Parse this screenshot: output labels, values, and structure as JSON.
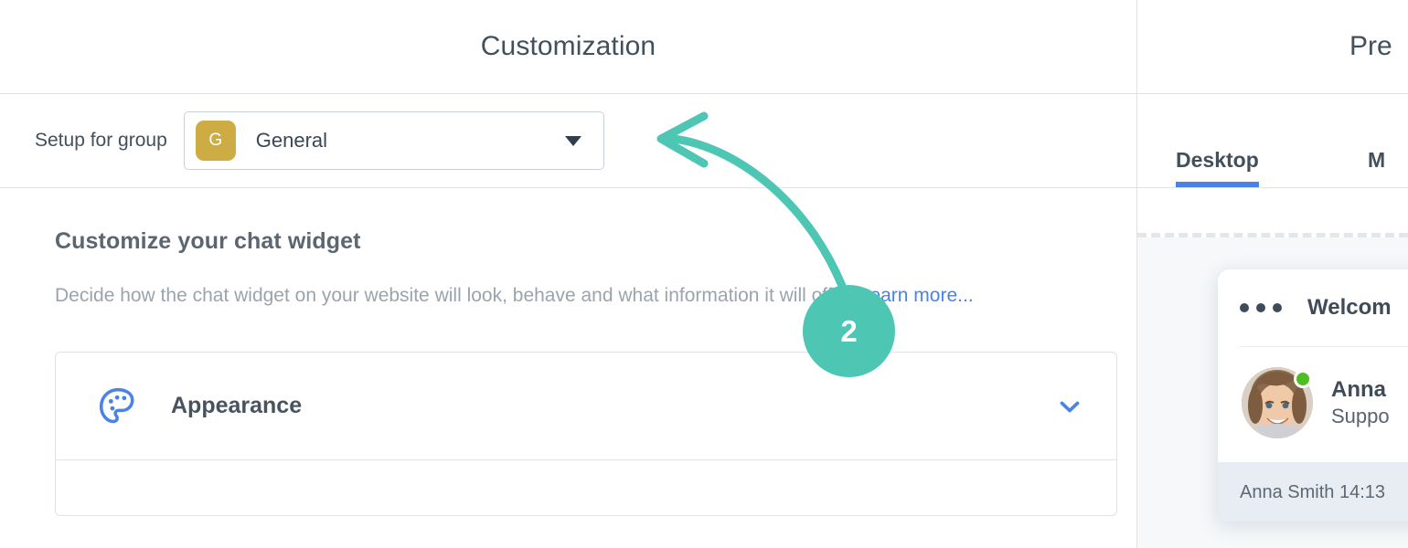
{
  "left": {
    "header": {
      "title": "Customization"
    },
    "group_bar": {
      "label": "Setup for group",
      "avatar_initial": "G",
      "avatar_color": "#ceac44",
      "selected_group": "General",
      "caret_icon": "caret-down-icon"
    },
    "content": {
      "title": "Customize your chat widget",
      "description": "Decide how the chat widget on your website will look, behave and what information it will offer. ",
      "learn_more": "Learn more...",
      "link_color": "#4a82e8"
    },
    "cards": [
      {
        "icon": "palette-icon",
        "label": "Appearance",
        "chevron": "chevron-down-icon",
        "icon_color": "#4a82e8"
      }
    ]
  },
  "right": {
    "header": {
      "title": "Pre"
    },
    "tabs": [
      {
        "label": "Desktop",
        "active": true
      },
      {
        "label": "M",
        "active": false
      }
    ],
    "active_tab_color": "#4a82e8",
    "widget": {
      "menu_icon": "ellipsis-icon",
      "welcome_title": "Welcom",
      "agent_name": "Anna",
      "agent_role": "Suppo",
      "online_status_color": "#4fbd24",
      "avatar_icon": "avatar",
      "message_meta": "Anna Smith 14:13"
    }
  },
  "annotation": {
    "step_number": "2",
    "accent_color": "#4ec6b4",
    "arrow_icon": "curved-arrow-icon"
  }
}
